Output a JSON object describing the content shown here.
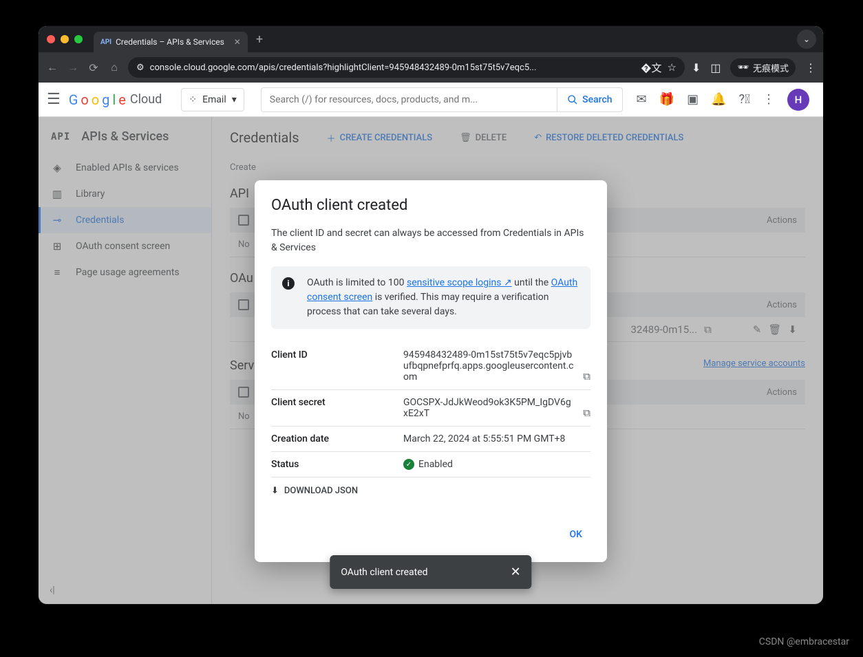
{
  "browser": {
    "tab_title": "Credentials – APIs & Services",
    "url": "console.cloud.google.com/apis/credentials?highlightClient=945948432489-0m15st75t5v7eqc5...",
    "incognito_label": "无痕模式"
  },
  "header": {
    "logo_suffix": "Cloud",
    "project": "Email",
    "search_placeholder": "Search (/) for resources, docs, products, and m...",
    "search_button": "Search",
    "avatar_initial": "H"
  },
  "sidebar": {
    "title": "APIs & Services",
    "items": [
      {
        "label": "Enabled APIs & services"
      },
      {
        "label": "Library"
      },
      {
        "label": "Credentials"
      },
      {
        "label": "OAuth consent screen"
      },
      {
        "label": "Page usage agreements"
      }
    ]
  },
  "main": {
    "title": "Credentials",
    "create_btn": "CREATE CREDENTIALS",
    "delete_btn": "DELETE",
    "restore_btn": "RESTORE DELETED CREDENTIALS",
    "create_note": "Create",
    "api_section": "API",
    "oauth_section": "OAu",
    "service_section": "Serv",
    "actions_col": "Actions",
    "no_data": "No",
    "client_short": "32489-0m15...",
    "manage_link": "Manage service accounts"
  },
  "modal": {
    "title": "OAuth client created",
    "subtitle": "The client ID and secret can always be accessed from Credentials in APIs & Services",
    "info_prefix": "OAuth is limited to 100 ",
    "info_link1": "sensitive scope logins",
    "info_mid": " until the ",
    "info_link2": "OAuth consent screen",
    "info_suffix": " is verified. This may require a verification process that can take several days.",
    "client_id_label": "Client ID",
    "client_id": "945948432489-0m15st75t5v7eqc5pjvbufbqpnefprfq.apps.googleusercontent.com",
    "client_secret_label": "Client secret",
    "client_secret": "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",
    "creation_label": "Creation date",
    "creation": "March 22, 2024 at 5:55:51 PM GMT+8",
    "status_label": "Status",
    "status": "Enabled",
    "download": "DOWNLOAD JSON",
    "ok": "OK"
  },
  "toast": {
    "msg": "OAuth client created"
  },
  "watermark": "CSDN @embracestar"
}
